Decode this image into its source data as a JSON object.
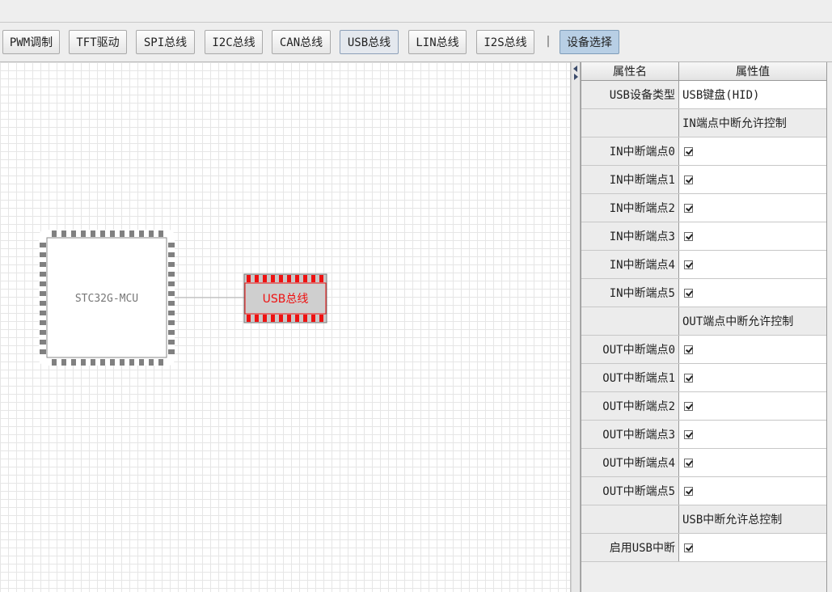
{
  "toolbar": {
    "buttons": [
      "PWM调制",
      "TFT驱动",
      "SPI总线",
      "I2C总线",
      "CAN总线",
      "USB总线",
      "LIN总线",
      "I2S总线"
    ],
    "separator": "|",
    "device_select": "设备选择"
  },
  "canvas": {
    "mcu_label": "STC32G-MCU",
    "usb_block_label": "USB总线"
  },
  "properties": {
    "header": {
      "name": "属性名",
      "value": "属性值"
    },
    "rows": [
      {
        "name": "USB设备类型",
        "value": "USB键盘(HID)"
      },
      {
        "name": "",
        "value": "IN端点中断允许控制"
      },
      {
        "name": "IN中断端点0",
        "checked": true
      },
      {
        "name": "IN中断端点1",
        "checked": true
      },
      {
        "name": "IN中断端点2",
        "checked": true
      },
      {
        "name": "IN中断端点3",
        "checked": true
      },
      {
        "name": "IN中断端点4",
        "checked": true
      },
      {
        "name": "IN中断端点5",
        "checked": true
      },
      {
        "name": "",
        "value": "OUT端点中断允许控制"
      },
      {
        "name": "OUT中断端点0",
        "checked": true
      },
      {
        "name": "OUT中断端点1",
        "checked": true
      },
      {
        "name": "OUT中断端点2",
        "checked": true
      },
      {
        "name": "OUT中断端点3",
        "checked": true
      },
      {
        "name": "OUT中断端点4",
        "checked": true
      },
      {
        "name": "OUT中断端点5",
        "checked": true
      },
      {
        "name": "",
        "value": "USB中断允许总控制"
      },
      {
        "name": "启用USB中断",
        "checked": true
      }
    ]
  },
  "colors": {
    "usb_red": "#ee1111",
    "selected_button": "#b8cfe5"
  },
  "icons": [
    "splitter-collapse-left-icon",
    "splitter-expand-right-icon",
    "checkbox-checked-icon"
  ]
}
